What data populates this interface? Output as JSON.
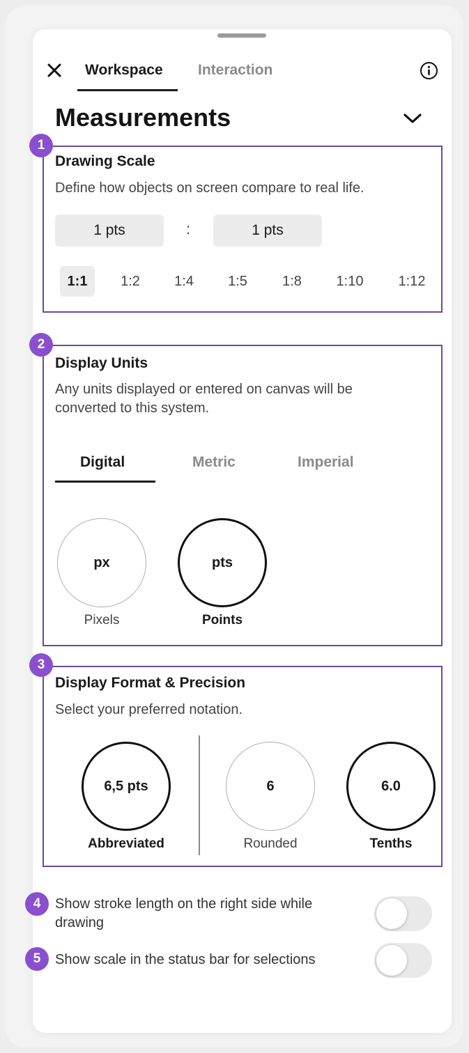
{
  "header": {
    "tabs": [
      {
        "label": "Workspace",
        "active": true
      },
      {
        "label": "Interaction",
        "active": false
      }
    ],
    "close_icon": "close-icon",
    "info_icon": "info-icon"
  },
  "page": {
    "title": "Measurements",
    "chevron_icon": "chevron-down-icon"
  },
  "drawing_scale": {
    "badge": "1",
    "title": "Drawing Scale",
    "description": "Define how objects on screen compare to real life.",
    "left_value": "1 pts",
    "separator": ":",
    "right_value": "1 pts",
    "ratios": [
      "1:1",
      "1:2",
      "1:4",
      "1:5",
      "1:8",
      "1:10",
      "1:12"
    ],
    "selected_ratio": "1:1"
  },
  "display_units": {
    "badge": "2",
    "title": "Display Units",
    "description": "Any units displayed or entered on canvas will be converted to this system.",
    "tabs": [
      "Digital",
      "Metric",
      "Imperial"
    ],
    "active_tab": "Digital",
    "options": [
      {
        "symbol": "px",
        "label": "Pixels",
        "selected": false
      },
      {
        "symbol": "pts",
        "label": "Points",
        "selected": true
      }
    ]
  },
  "display_format": {
    "badge": "3",
    "title": "Display Format & Precision",
    "description": "Select your preferred notation.",
    "format_options": [
      {
        "value": "6,5 pts",
        "label": "Abbreviated",
        "selected": true
      }
    ],
    "precision_options": [
      {
        "value": "6",
        "label": "Rounded",
        "selected": false
      },
      {
        "value": "6.0",
        "label": "Tenths",
        "selected": true
      }
    ]
  },
  "toggles": [
    {
      "badge": "4",
      "label": "Show stroke length on the right side while drawing",
      "on": false
    },
    {
      "badge": "5",
      "label": "Show scale in the status bar for selections",
      "on": false
    }
  ],
  "colors": {
    "accent": "#8a4fcf",
    "section_border": "#6b4a9e",
    "toggle_off": "#e9e9e9"
  }
}
